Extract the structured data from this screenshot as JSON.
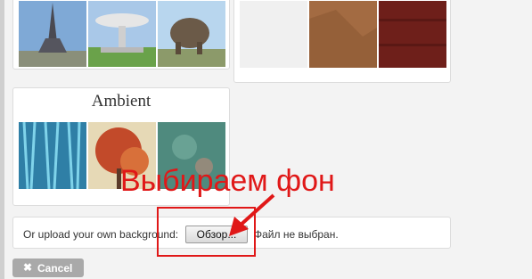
{
  "ambient_card": {
    "title": "Ambient"
  },
  "upload": {
    "label": "Or upload your own background:",
    "file_button_label": "Обзор...",
    "file_status": "Файл не выбран."
  },
  "actions": {
    "cancel_label": "Cancel",
    "cancel_icon": "close-x-icon"
  },
  "annotation": {
    "text": "Выбираем фон",
    "color": "#e01818"
  },
  "thumbnails": {
    "top_left": [
      "eiffel-tower",
      "starship-statue",
      "bison-statue"
    ],
    "top_right": [
      "white-linen-texture",
      "brown-paper-texture",
      "red-wood-texture"
    ],
    "ambient": [
      "blue-fibers",
      "autumn-tree",
      "teal-abstract"
    ]
  }
}
